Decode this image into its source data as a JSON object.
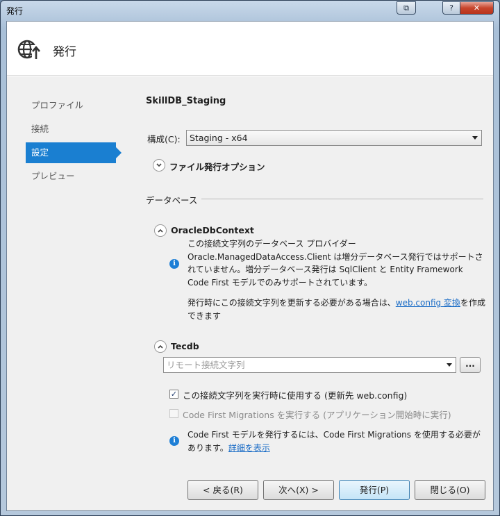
{
  "window": {
    "title": "発行",
    "help_glyph": "?",
    "close_glyph": "✕",
    "restore_glyph": "⧉"
  },
  "header": {
    "title": "発行",
    "icon": "globe-publish-icon"
  },
  "nav": {
    "items": [
      {
        "label": "プロファイル"
      },
      {
        "label": "接続"
      },
      {
        "label": "設定"
      },
      {
        "label": "プレビュー"
      }
    ],
    "active_index": 2
  },
  "settings": {
    "profile_name": "SkillDB_Staging",
    "config_label": "構成(C):",
    "config_value": "Staging - x64",
    "file_options_label": "ファイル発行オプション",
    "database_section_label": "データベース",
    "oracle": {
      "name": "OracleDbContext",
      "info_text": "この接続文字列のデータベース プロバイダー Oracle.ManagedDataAccess.Client は増分データベース発行ではサポートされていません。増分データベース発行は SqlClient と Entity Framework Code First モデルでのみサポートされています。",
      "update_text_before": "発行時にこの接続文字列を更新する必要がある場合は、",
      "update_link": "web.config 変換",
      "update_text_after": "を作成できます"
    },
    "tecdb": {
      "name": "Tecdb",
      "remote_placeholder": "リモート接続文字列",
      "dots_label": "...",
      "use_at_runtime_label": "この接続文字列を実行時に使用する (更新先 web.config)",
      "use_at_runtime_checked": true,
      "run_migrations_label": "Code First Migrations を実行する (アプリケーション開始時に実行)",
      "run_migrations_checked": false,
      "info_text": "Code First モデルを発行するには、Code First Migrations を使用する必要があります。",
      "info_link": "詳細を表示"
    }
  },
  "buttons": {
    "prev": "< 戻る(R)",
    "next": "次へ(X) >",
    "publish": "発行(P)",
    "close": "閉じる(O)"
  },
  "colors": {
    "accent": "#1a7fd1",
    "link": "#1a6cc6",
    "info": "#1e7fd6"
  }
}
